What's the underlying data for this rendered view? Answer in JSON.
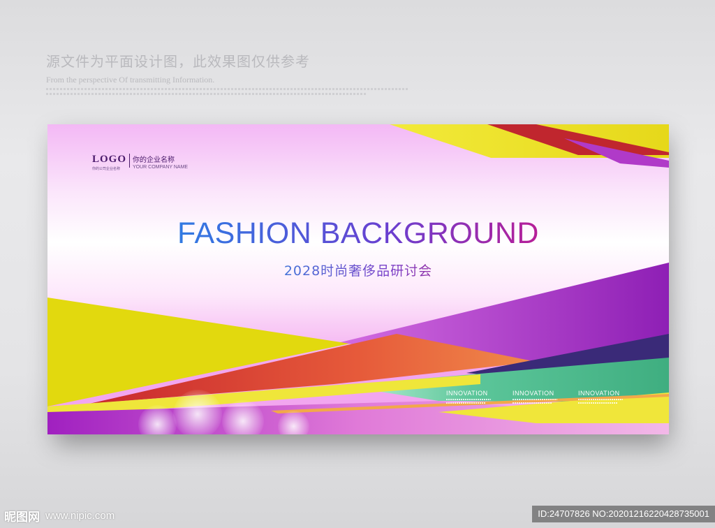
{
  "top_note": {
    "cn": "源文件为平面设计图，此效果图仅供参考",
    "en": "From the perspective Of transmitting Information."
  },
  "banner": {
    "logo": {
      "mark": "LOGO",
      "sub": "你的公司企业名称",
      "name": "你的企业名称",
      "en": "YOUR COMPANY NAME"
    },
    "title": "FASHION BACKGROUND",
    "subtitle": "2028时尚奢侈品研讨会",
    "innovation": [
      {
        "title": "INNOVATION"
      },
      {
        "title": "INNOVATION"
      },
      {
        "title": "INNOVATION"
      }
    ]
  },
  "footer": {
    "site_brand": "昵图网",
    "site_url": "www.nipic.com",
    "id_text": "ID:24707826 NO:20201216220428735001"
  },
  "colors": {
    "yellow": "#e9e21a",
    "purple": "#8e1fb5",
    "red": "#c8282e",
    "green": "#4fb98a",
    "navy": "#3a2a78",
    "magenta": "#d23cc8"
  }
}
